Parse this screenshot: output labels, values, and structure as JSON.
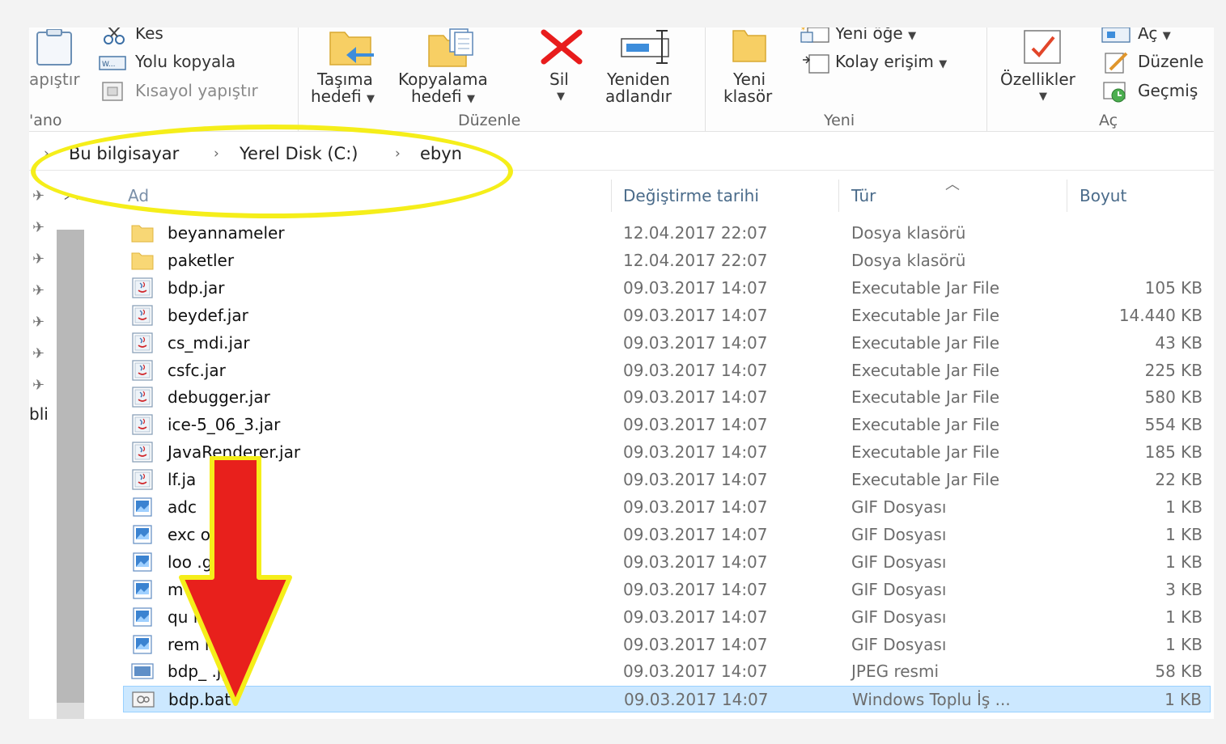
{
  "ribbon": {
    "clipboard": {
      "paste_label": "apıştır",
      "cut_label": "Kes",
      "copy_path_label": "Yolu kopyala",
      "paste_shortcut_label": "Kısayol yapıştır",
      "group_label": "'ano"
    },
    "organize": {
      "move_to_line1": "Taşıma",
      "move_to_line2": "hedefi",
      "copy_to_line1": "Kopyalama",
      "copy_to_line2": "hedefi",
      "delete_label": "Sil",
      "rename_line1": "Yeniden",
      "rename_line2": "adlandır",
      "group_label": "Düzenle"
    },
    "new": {
      "new_folder_line1": "Yeni",
      "new_folder_line2": "klasör",
      "new_item_label": "Yeni öğe",
      "easy_access_label": "Kolay erişim",
      "group_label": "Yeni"
    },
    "open": {
      "properties_label": "Özellikler",
      "open_label": "Aç",
      "edit_label": "Düzenle",
      "history_label": "Geçmiş",
      "group_label": "Aç"
    }
  },
  "breadcrumb": {
    "items": [
      "Bu bilgisayar",
      "Yerel Disk (C:)",
      "ebyn"
    ]
  },
  "nav": {
    "label": "bli"
  },
  "columns": {
    "name": "Ad",
    "date": "Değiştirme tarihi",
    "type": "Tür",
    "size": "Boyut"
  },
  "files": [
    {
      "name": "beyannameler",
      "date": "12.04.2017 22:07",
      "type": "Dosya klasörü",
      "size": "",
      "icon": "folder-icon"
    },
    {
      "name": "paketler",
      "date": "12.04.2017 22:07",
      "type": "Dosya klasörü",
      "size": "",
      "icon": "folder-icon"
    },
    {
      "name": "bdp.jar",
      "date": "09.03.2017 14:07",
      "type": "Executable Jar File",
      "size": "105 KB",
      "icon": "java-jar-icon"
    },
    {
      "name": "beydef.jar",
      "date": "09.03.2017 14:07",
      "type": "Executable Jar File",
      "size": "14.440 KB",
      "icon": "java-jar-icon"
    },
    {
      "name": "cs_mdi.jar",
      "date": "09.03.2017 14:07",
      "type": "Executable Jar File",
      "size": "43 KB",
      "icon": "java-jar-icon"
    },
    {
      "name": "csfc.jar",
      "date": "09.03.2017 14:07",
      "type": "Executable Jar File",
      "size": "225 KB",
      "icon": "java-jar-icon"
    },
    {
      "name": "debugger.jar",
      "date": "09.03.2017 14:07",
      "type": "Executable Jar File",
      "size": "580 KB",
      "icon": "java-jar-icon"
    },
    {
      "name": "ice-5_06_3.jar",
      "date": "09.03.2017 14:07",
      "type": "Executable Jar File",
      "size": "554 KB",
      "icon": "java-jar-icon"
    },
    {
      "name": "JavaRenderer.jar",
      "date": "09.03.2017 14:07",
      "type": "Executable Jar File",
      "size": "185 KB",
      "icon": "java-jar-icon"
    },
    {
      "name": "lf.ja",
      "date": "09.03.2017 14:07",
      "type": "Executable Jar File",
      "size": "22 KB",
      "icon": "java-jar-icon"
    },
    {
      "name": "adc",
      "date": "09.03.2017 14:07",
      "type": "GIF Dosyası",
      "size": "1 KB",
      "icon": "gif-image-icon"
    },
    {
      "name": "exc ort.gif",
      "date": "09.03.2017 14:07",
      "type": "GIF Dosyası",
      "size": "1 KB",
      "icon": "gif-image-icon"
    },
    {
      "name": "loo .gif",
      "date": "09.03.2017 14:07",
      "type": "GIF Dosyası",
      "size": "1 KB",
      "icon": "gif-image-icon"
    },
    {
      "name": "m anligi.gif",
      "date": "09.03.2017 14:07",
      "type": "GIF Dosyası",
      "size": "3 KB",
      "icon": "gif-image-icon"
    },
    {
      "name": "qu if",
      "date": "09.03.2017 14:07",
      "type": "GIF Dosyası",
      "size": "1 KB",
      "icon": "gif-image-icon"
    },
    {
      "name": "rem if",
      "date": "09.03.2017 14:07",
      "type": "GIF Dosyası",
      "size": "1 KB",
      "icon": "gif-image-icon"
    },
    {
      "name": "bdp_ .jpg",
      "date": "09.03.2017 14:07",
      "type": "JPEG resmi",
      "size": "58 KB",
      "icon": "jpeg-image-icon"
    },
    {
      "name": "bdp.bat",
      "date": "09.03.2017 14:07",
      "type": "Windows Toplu İş ...",
      "size": "1 KB",
      "icon": "batch-file-icon",
      "selected": true
    }
  ],
  "annotations": {
    "highlight_color": "#f5ee1a",
    "arrow_color": "#e8201c"
  }
}
